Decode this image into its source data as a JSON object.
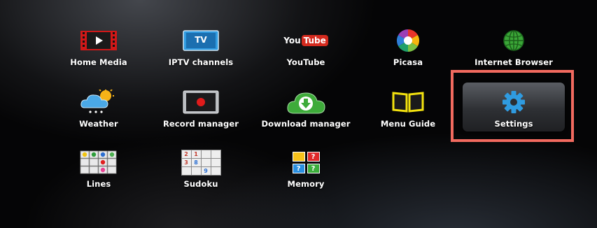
{
  "menu": {
    "items": [
      {
        "label": "Home Media",
        "icon": "home-media-icon"
      },
      {
        "label": "IPTV channels",
        "icon": "tv-icon",
        "icon_text": "TV"
      },
      {
        "label": "YouTube",
        "icon": "youtube-icon",
        "icon_text_you": "You",
        "icon_text_tube": "Tube"
      },
      {
        "label": "Picasa",
        "icon": "picasa-icon"
      },
      {
        "label": "Internet Browser",
        "icon": "globe-icon"
      },
      {
        "label": "Weather",
        "icon": "weather-icon"
      },
      {
        "label": "Record manager",
        "icon": "record-icon"
      },
      {
        "label": "Download manager",
        "icon": "download-icon"
      },
      {
        "label": "Menu Guide",
        "icon": "book-icon"
      },
      {
        "label": "Settings",
        "icon": "gear-icon"
      },
      {
        "label": "Lines",
        "icon": "lines-game-icon"
      },
      {
        "label": "Sudoku",
        "icon": "sudoku-icon",
        "grid": [
          "2",
          "1",
          "",
          "3",
          "8",
          "",
          "",
          "",
          "9"
        ]
      },
      {
        "label": "Memory",
        "icon": "memory-game-icon",
        "cards": [
          "",
          "?",
          "?",
          "?"
        ]
      }
    ],
    "selected_label": "Settings"
  },
  "colors": {
    "highlight_frame": "#f26a5f",
    "accent_blue": "#2f9be0"
  }
}
